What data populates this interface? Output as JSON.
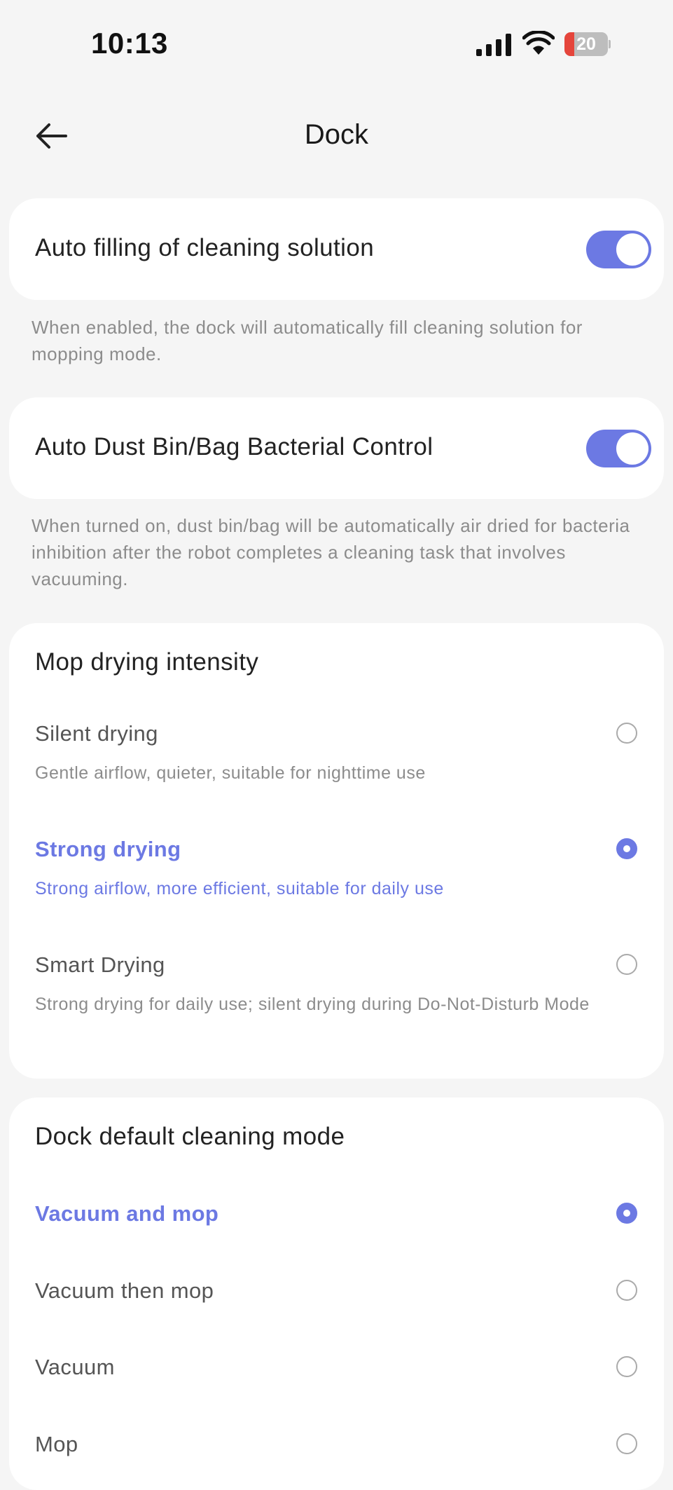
{
  "status_bar": {
    "time": "10:13",
    "battery": "20",
    "battery_color": "#e5453b"
  },
  "header": {
    "title": "Dock",
    "back_icon": "arrow-left-icon"
  },
  "accent_color": "#6c79e3",
  "auto_fill": {
    "label": "Auto filling of cleaning solution",
    "enabled": true,
    "description": "When enabled, the dock will automatically fill cleaning solution for mopping mode."
  },
  "bacterial_control": {
    "label": "Auto Dust Bin/Bag Bacterial Control",
    "enabled": true,
    "description": "When turned on, dust bin/bag will be automatically air dried for bacteria inhibition after the robot completes a cleaning task that involves vacuuming."
  },
  "mop_drying": {
    "title": "Mop drying intensity",
    "options": [
      {
        "label": "Silent drying",
        "description": "Gentle airflow, quieter, suitable for nighttime use",
        "selected": false
      },
      {
        "label": "Strong drying",
        "description": "Strong airflow, more efficient, suitable for daily use",
        "selected": true
      },
      {
        "label": "Smart Drying",
        "description": "Strong drying for daily use; silent drying during Do-Not-Disturb Mode",
        "selected": false
      }
    ]
  },
  "cleaning_mode": {
    "title": "Dock default cleaning mode",
    "options": [
      {
        "label": "Vacuum and mop",
        "selected": true
      },
      {
        "label": "Vacuum then mop",
        "selected": false
      },
      {
        "label": "Vacuum",
        "selected": false
      },
      {
        "label": "Mop",
        "selected": false
      }
    ]
  }
}
